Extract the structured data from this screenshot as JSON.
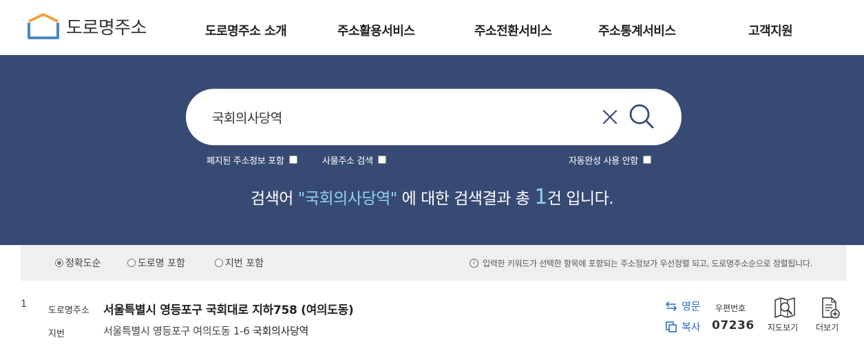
{
  "header": {
    "logo_text": "도로명주소",
    "nav": [
      "도로명주소 소개",
      "주소활용서비스",
      "주소전환서비스",
      "주소통계서비스",
      "고객지원"
    ]
  },
  "search": {
    "value": "국회의사당역",
    "options": {
      "include_abolished": "폐지된 주소정보 포함",
      "thing_address": "사물주소 검색",
      "autocomplete_off": "자동완성 사용 안함"
    }
  },
  "result_message": {
    "prefix": "검색어 ",
    "keyword": "\"국회의사당역\"",
    "middle": " 에 대한 검색결과 총 ",
    "count": "1",
    "suffix": "건 입니다."
  },
  "sort": {
    "options": [
      "정확도순",
      "도로명 포함",
      "지번 포함"
    ],
    "selected": "정확도순",
    "info": "입력한 키워드가 선택한 항목에 포함되는 주소정보가 우선정렬 되고, 도로명주소순으로 정렬됩니다."
  },
  "results": [
    {
      "num": "1",
      "road_label": "도로명주소",
      "road_address": "서울특별시 영등포구 국회대로 지하758 (여의도동)",
      "jibun_label": "지번",
      "jibun_address": "서울특별시 영등포구 여의도동 1-6",
      "building_name": "국회의사당역",
      "english_label": "영문",
      "copy_label": "복사",
      "zip_label": "우편번호",
      "zip_code": "07236",
      "map_label": "지도보기",
      "more_label": "더보기"
    }
  ],
  "colors": {
    "band": "#374a74",
    "accent": "#8fd3f4",
    "link": "#2a6fc9",
    "logo_orange": "#f0a23c",
    "logo_blue": "#4a86c5"
  }
}
